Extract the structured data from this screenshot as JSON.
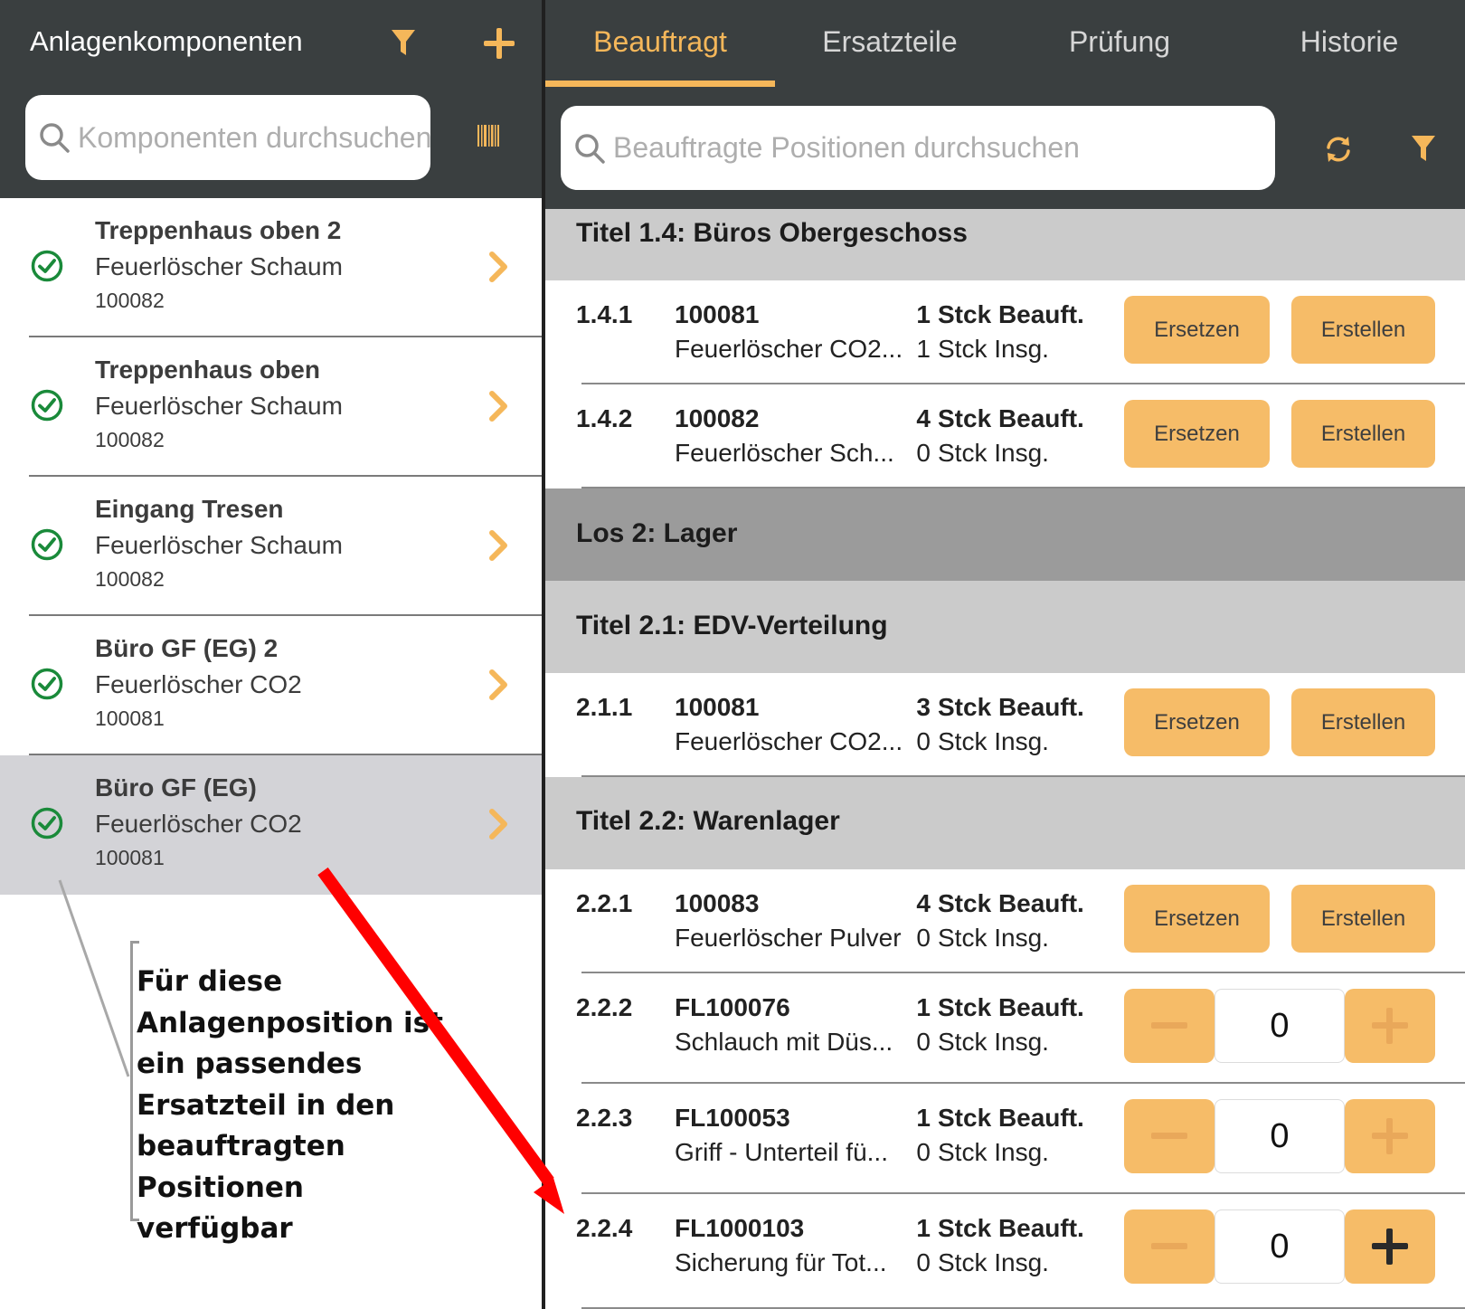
{
  "colors": {
    "header_bg": "#3a3f40",
    "accent": "#f5b75a",
    "button": "#f6bc68",
    "check_green": "#1a8a3a",
    "section_light": "#cbcbcb",
    "section_dark": "#9b9b9b",
    "selected_row": "#d3d3d7",
    "annotation_arrow": "#ff0000"
  },
  "left": {
    "title": "Anlagenkomponenten",
    "filter_icon": "filter-icon",
    "add_icon": "plus-icon",
    "barcode_icon": "barcode-icon",
    "search": {
      "placeholder": "Komponenten durchsuchen",
      "value": ""
    },
    "components": [
      {
        "name": "Treppenhaus oben 2",
        "type": "Feuerlöscher Schaum",
        "number": "100082",
        "status_icon": "check-circle-icon",
        "selected": false
      },
      {
        "name": "Treppenhaus oben",
        "type": "Feuerlöscher Schaum",
        "number": "100082",
        "status_icon": "check-circle-icon",
        "selected": false
      },
      {
        "name": "Eingang Tresen",
        "type": "Feuerlöscher Schaum",
        "number": "100082",
        "status_icon": "check-circle-icon",
        "selected": false
      },
      {
        "name": "Büro GF (EG) 2",
        "type": "Feuerlöscher CO2",
        "number": "100081",
        "status_icon": "check-circle-icon",
        "selected": false
      },
      {
        "name": "Büro GF (EG)",
        "type": "Feuerlöscher CO2",
        "number": "100081",
        "status_icon": "check-circle-icon",
        "selected": true
      }
    ]
  },
  "annotation": {
    "lines": [
      "Für diese",
      "Anlagenposition ist",
      "ein passendes",
      "Ersatzteil in den",
      "beauftragten",
      "Positionen verfügbar"
    ]
  },
  "right": {
    "tabs": [
      {
        "label": "Beauftragt",
        "active": true
      },
      {
        "label": "Ersatzteile",
        "active": false
      },
      {
        "label": "Prüfung",
        "active": false
      },
      {
        "label": "Historie",
        "active": false
      }
    ],
    "search": {
      "placeholder": "Beauftragte Positionen durchsuchen",
      "value": ""
    },
    "refresh_icon": "refresh-icon",
    "filter_icon": "filter-icon",
    "unit": "Stck",
    "label_ordered": "Beauft.",
    "label_total": "Insg.",
    "btn_replace": "Ersetzen",
    "btn_create": "Erstellen",
    "sections": [
      {
        "title": "Titel 1.4: Büros Obergeschoss",
        "style": "light"
      },
      {
        "title": "Los 2: Lager",
        "style": "dark"
      },
      {
        "title": "Titel 2.1: EDV-Verteilung",
        "style": "light"
      },
      {
        "title": "Titel 2.2: Warenlager",
        "style": "light"
      }
    ],
    "positions": [
      {
        "pos": "1.4.1",
        "part": "100081",
        "desc": "Feuerlöscher CO2...",
        "ordered": "1",
        "total": "1",
        "control": "buttons"
      },
      {
        "pos": "1.4.2",
        "part": "100082",
        "desc": "Feuerlöscher Sch...",
        "ordered": "4",
        "total": "0",
        "control": "buttons"
      },
      {
        "pos": "2.1.1",
        "part": "100081",
        "desc": "Feuerlöscher CO2...",
        "ordered": "3",
        "total": "0",
        "control": "buttons"
      },
      {
        "pos": "2.2.1",
        "part": "100083",
        "desc": "Feuerlöscher Pulver",
        "ordered": "4",
        "total": "0",
        "control": "buttons"
      },
      {
        "pos": "2.2.2",
        "part": "FL100076",
        "desc": "Schlauch mit Düs...",
        "ordered": "1",
        "total": "0",
        "control": "stepper",
        "value": "0",
        "plus_enabled": false
      },
      {
        "pos": "2.2.3",
        "part": "FL100053",
        "desc": "Griff - Unterteil fü...",
        "ordered": "1",
        "total": "0",
        "control": "stepper",
        "value": "0",
        "plus_enabled": false
      },
      {
        "pos": "2.2.4",
        "part": "FL1000103",
        "desc": "Sicherung für Tot...",
        "ordered": "1",
        "total": "0",
        "control": "stepper",
        "value": "0",
        "plus_enabled": true
      }
    ]
  }
}
